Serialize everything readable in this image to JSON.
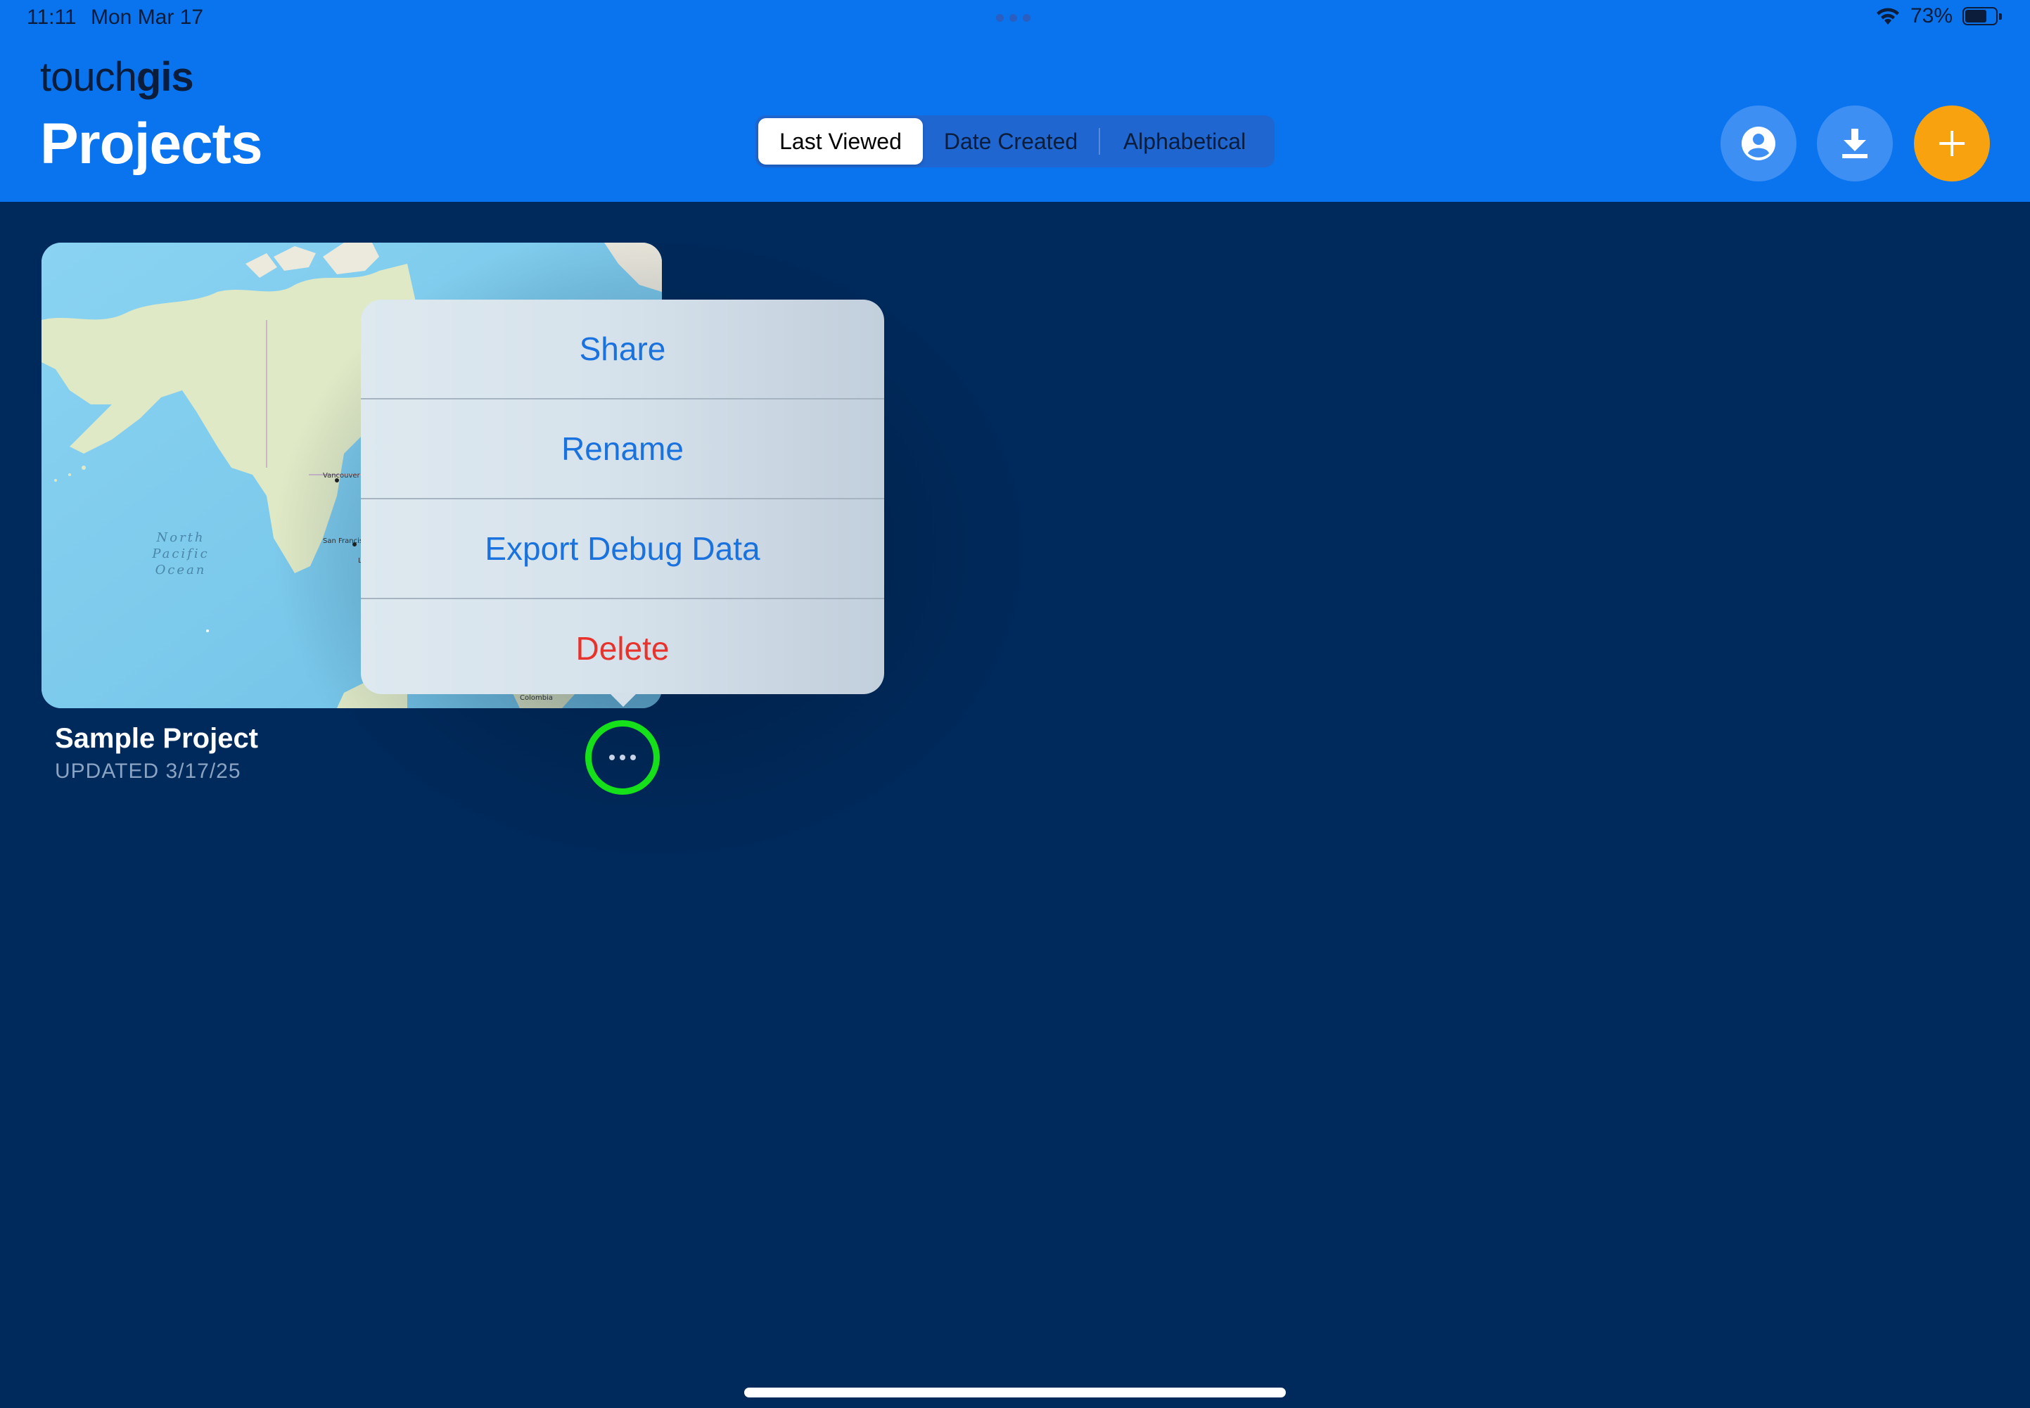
{
  "status_bar": {
    "time": "11:11",
    "date": "Mon Mar 17",
    "battery": "73%",
    "battery_level": 0.73
  },
  "header": {
    "logo_light": "touch",
    "logo_bold": "gis",
    "title": "Projects",
    "sort_options": [
      "Last Viewed",
      "Date Created",
      "Alphabetical"
    ],
    "active_sort": "Last Viewed",
    "buttons": [
      {
        "name": "account",
        "icon": "person-circle-icon"
      },
      {
        "name": "download",
        "icon": "download-icon"
      },
      {
        "name": "add",
        "icon": "plus-icon"
      }
    ],
    "colors": {
      "bar": "#0a74ee",
      "add_button": "#f9a20f"
    }
  },
  "project": {
    "name": "Sample Project",
    "updated": "UPDATED 3/17/25",
    "map_labels": {
      "ocean": "North\nPacific\nOcean",
      "cities": [
        "Vancouver",
        "San Francisco",
        "Los Angeles",
        "Colombia"
      ]
    }
  },
  "context_menu": {
    "items": [
      {
        "label": "Share",
        "destructive": false
      },
      {
        "label": "Rename",
        "destructive": false
      },
      {
        "label": "Export Debug Data",
        "destructive": false
      },
      {
        "label": "Delete",
        "destructive": true
      }
    ],
    "colors": {
      "action": "#1a72de",
      "destructive": "#e8332c"
    }
  },
  "highlight": {
    "color": "#16e01a"
  }
}
